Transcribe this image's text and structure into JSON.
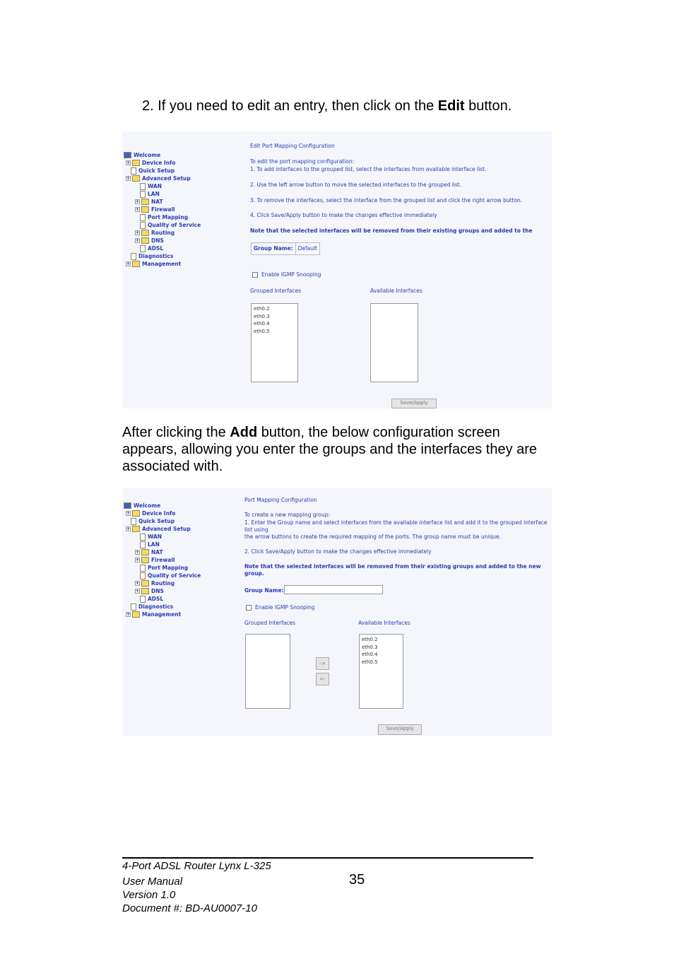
{
  "step2": {
    "prefix": "2.  If you need to edit an entry, then click on the ",
    "bold": "Edit",
    "suffix": " button."
  },
  "paragraph": {
    "prefix": "After clicking the ",
    "bold": "Add",
    "suffix": " button, the below configuration screen appears, allowing you enter the groups and the interfaces they are associated with."
  },
  "tree": [
    "Welcome",
    "Device Info",
    "Quick Setup",
    "Advanced Setup",
    "WAN",
    "LAN",
    "NAT",
    "Firewall",
    "Port Mapping",
    "Quality of Service",
    "Routing",
    "DNS",
    "ADSL",
    "Diagnostics",
    "Management"
  ],
  "edit": {
    "title": "Edit Port Mapping Configuration",
    "intro": "To edit the port mapping configuration:",
    "s1": "1. To add interfaces to the grouped list, select the interfaces from available interface list.",
    "s2": "2. Use the left arrow button to move the selected interfaces to the grouped list.",
    "s3": "3. To remove the interfaces, select the interface from the grouped list and click the right arrow button.",
    "s4": "4. Click Save/Apply button to make the changes effective immediately",
    "note": "Note that the selected interfaces will be removed from their existing groups and added to the",
    "group_label": "Group Name:",
    "group_value": "Default",
    "igmp": "Enable IGMP Snooping",
    "grouped": "Grouped Interfaces",
    "available": "Available Interfaces",
    "grouped_items": [
      "eth0.2",
      "eth0.3",
      "eth0.4",
      "eth0.5"
    ],
    "save": "Save/Apply"
  },
  "add": {
    "title": "Port Mapping Configuration",
    "intro": "To create a new mapping group:",
    "s1a": "1. Enter the Group name and select interfaces from the available interface list and add it to the grouped interface list using",
    "s1b": "the arrow buttons to create the required mapping of the ports. The group name must be unique.",
    "s2": "2. Click Save/Apply button to make the changes effective immediately",
    "note": "Note that the selected interfaces will be removed from their existing groups and added to the new group.",
    "group_label": "Group Name:",
    "igmp": "Enable IGMP Snooping",
    "grouped": "Grouped Interfaces",
    "available": "Available Interfaces",
    "available_items": [
      "eth0.2",
      "eth0.3",
      "eth0.4",
      "eth0.5"
    ],
    "right_arrow": "->",
    "left_arrow": "<-",
    "save": "Save/Apply"
  },
  "footer": {
    "product": "4-Port ADSL Router Lynx L-325",
    "manual": "User Manual",
    "version": "Version 1.0",
    "document": "Document #:  BD-AU0007-10",
    "page": "35"
  }
}
